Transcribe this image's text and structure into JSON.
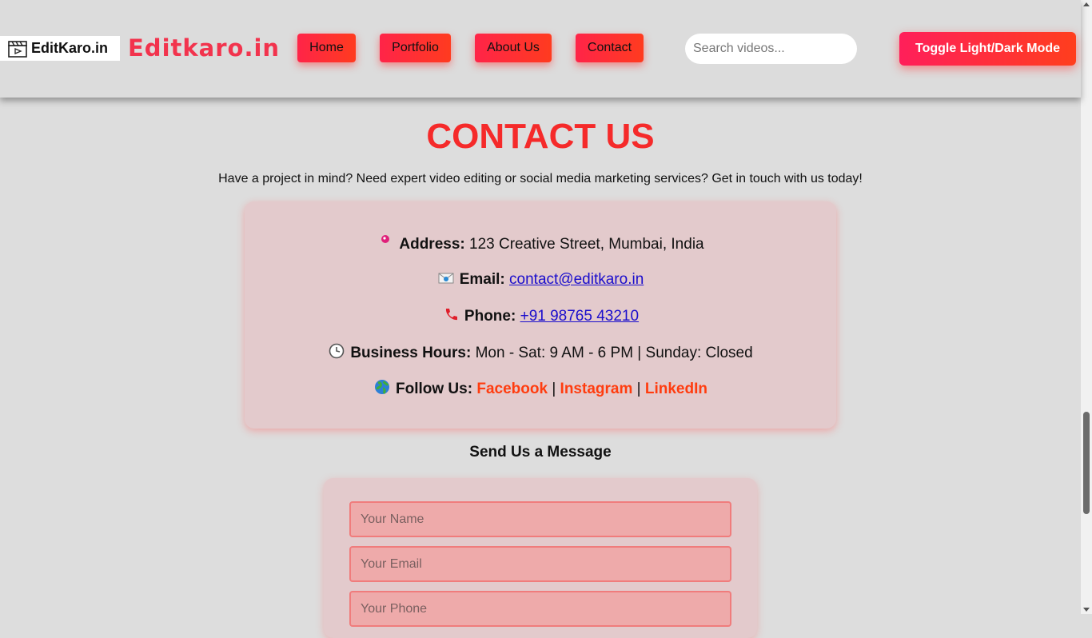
{
  "header": {
    "logo_text": "EditKaro.in",
    "brand": "Editkaro.in",
    "nav": [
      "Home",
      "Portfolio",
      "About Us",
      "Contact"
    ],
    "search_placeholder": "Search videos...",
    "toggle_label": "Toggle Light/Dark Mode"
  },
  "contact": {
    "title": "CONTACT US",
    "intro": "Have a project in mind? Need expert video editing or social media marketing services? Get in touch with us today!",
    "address_label": "Address:",
    "address_value": "123 Creative Street, Mumbai, India",
    "email_label": "Email:",
    "email_value": "contact@editkaro.in",
    "phone_label": "Phone:",
    "phone_value": "+91 98765 43210",
    "hours_label": "Business Hours:",
    "hours_value": "Mon - Sat: 9 AM - 6 PM | Sunday: Closed",
    "follow_label": "Follow Us:",
    "social": [
      "Facebook",
      "Instagram",
      "LinkedIn"
    ],
    "separator": "|"
  },
  "form": {
    "title": "Send Us a Message",
    "name_placeholder": "Your Name",
    "email_placeholder": "Your Email",
    "phone_placeholder": "Your Phone"
  },
  "icons": {
    "address": "pin-icon",
    "email": "envelope-icon",
    "phone": "telephone-icon",
    "hours": "clock-icon",
    "follow": "globe-icon"
  },
  "colors": {
    "accent": "#f52a2a",
    "brand": "#f2334d",
    "button_gradient_start": "#ff2448",
    "button_gradient_end": "#ff3b1f",
    "social_link": "#ff3c0f"
  }
}
